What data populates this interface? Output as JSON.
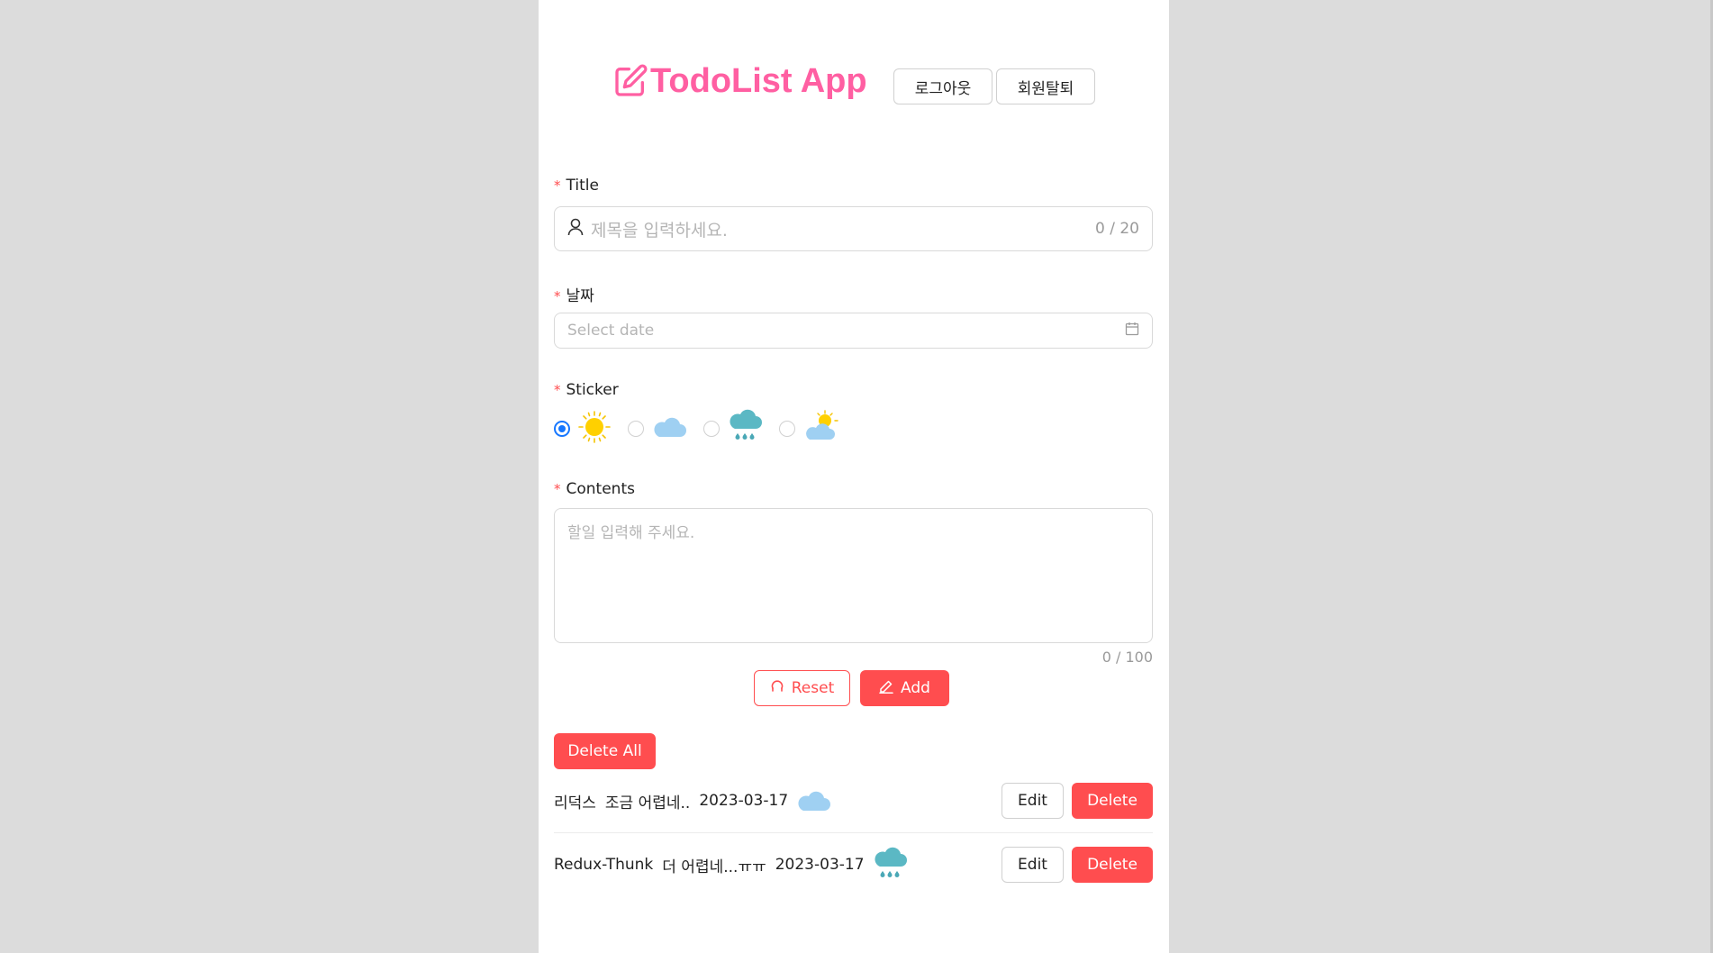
{
  "header": {
    "app_title": "TodoList App",
    "logout_label": "로그아웃",
    "withdraw_label": "회원탈퇴",
    "brand_color": "#ff5fa2"
  },
  "form": {
    "title": {
      "label": "Title",
      "placeholder": "제목을 입력하세요.",
      "count": "0 / 20"
    },
    "date": {
      "label": "날짜",
      "placeholder": "Select date"
    },
    "sticker": {
      "label": "Sticker",
      "options": [
        {
          "icon": "sun-icon",
          "selected": true
        },
        {
          "icon": "cloud-icon",
          "selected": false
        },
        {
          "icon": "rain-cloud-icon",
          "selected": false
        },
        {
          "icon": "partly-cloudy-icon",
          "selected": false
        }
      ]
    },
    "contents": {
      "label": "Contents",
      "placeholder": "할일 입력해 주세요.",
      "count": "0 / 100"
    },
    "required_mark": "*",
    "reset_label": "Reset",
    "add_label": "Add"
  },
  "list": {
    "delete_all_label": "Delete All",
    "items": [
      {
        "title": "리덕스",
        "content": "조금 어렵네..",
        "date": "2023-03-17",
        "sticker": "cloud-icon",
        "edit_label": "Edit",
        "delete_label": "Delete"
      },
      {
        "title": "Redux-Thunk",
        "content": "더 어렵네...ㅠㅠ",
        "date": "2023-03-17",
        "sticker": "rain-cloud-icon",
        "edit_label": "Edit",
        "delete_label": "Delete"
      }
    ]
  },
  "colors": {
    "accent": "#ff4d4f",
    "radio": "#1677ff",
    "background": "#dcdcdc"
  }
}
